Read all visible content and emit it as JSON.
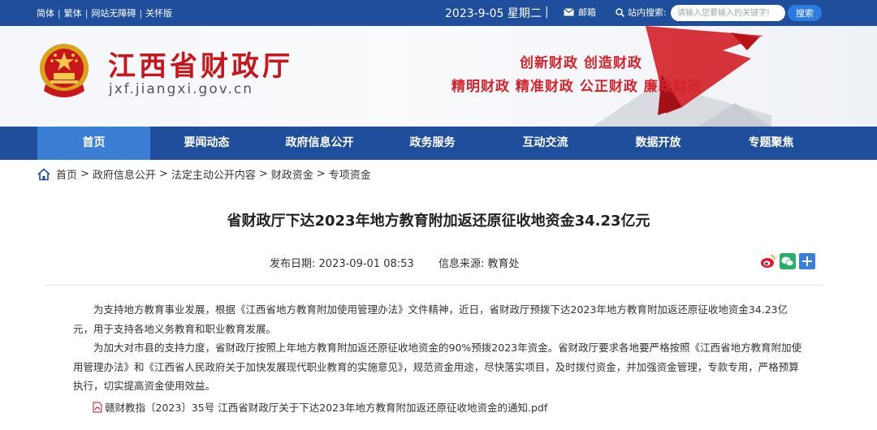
{
  "topbar": {
    "links": [
      "简体",
      "繁体",
      "网站无障碍",
      "关怀版"
    ],
    "date": "2023-9-05 星期二",
    "separator": "|",
    "mail_label": "邮箱",
    "search_label": "站内搜索:",
    "search_placeholder": "请输入您要输入的关键字!",
    "search_button": "搜索"
  },
  "banner": {
    "site_title": "江西省财政厅",
    "site_domain": "jxf.jiangxi.gov.cn",
    "slogan_line1": "创新财政  创造财政",
    "slogan_line2": "精明财政  精准财政  公正财政  廉政财政"
  },
  "nav": {
    "items": [
      "首页",
      "要闻动态",
      "政府信息公开",
      "政务服务",
      "互动交流",
      "数据开放",
      "专题聚焦"
    ],
    "active_index": 0
  },
  "breadcrumb": [
    "首页",
    "政府信息公开",
    "法定主动公开内容",
    "财政资金",
    "专项资金"
  ],
  "article": {
    "title": "省财政厅下达2023年地方教育附加返还原征收地资金34.23亿元",
    "publish_label": "发布日期:",
    "publish_date": "2023-09-01 08:53",
    "source_label": "信息来源:",
    "source": "教育处",
    "paragraph1": "为支持地方教育事业发展，根据《江西省地方教育附加使用管理办法》文件精神，近日，省财政厅预拨下达2023年地方教育附加返还原征收地资金34.23亿元，用于支持各地义务教育和职业教育发展。",
    "paragraph2": "为加大对市县的支持力度，省财政厅按照上年地方教育附加返还原征收地资金的90%预拨2023年资金。省财政厅要求各地要严格按照《江西省地方教育附加使用管理办法》和《江西省人民政府关于加快发展现代职业教育的实施意见》，规范资金用途，尽快落实项目，及时拨付资金，并加强资金管理，专款专用，严格预算执行，切实提高资金使用效益。",
    "attachment": "赣财教指〔2023〕35号 江西省财政厅关于下达2023年地方教育附加返还原征收地资金的通知.pdf"
  },
  "colors": {
    "primary_blue": "#1f4f9c",
    "active_nav": "#3b7ed6",
    "brand_red": "#c8161d"
  }
}
